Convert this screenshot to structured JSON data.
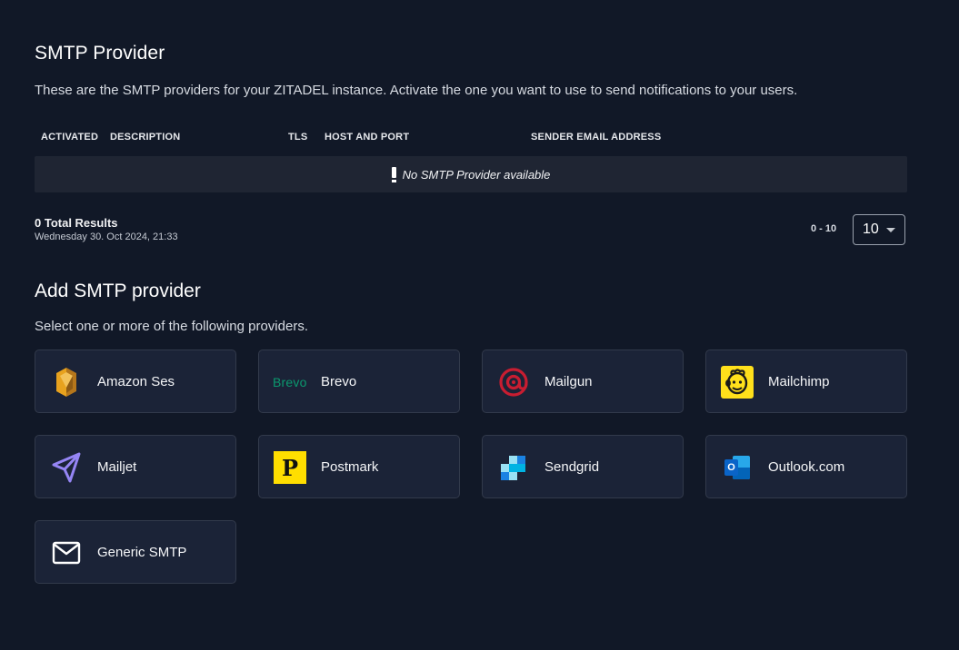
{
  "smtp_section": {
    "title": "SMTP Provider",
    "description": "These are the SMTP providers for your ZITADEL instance. Activate the one you want to use to send notifications to your users.",
    "columns": [
      "ACTIVATED",
      "DESCRIPTION",
      "TLS",
      "HOST AND PORT",
      "SENDER EMAIL ADDRESS"
    ],
    "empty_message": "No SMTP Provider available",
    "total_results": "0 Total Results",
    "timestamp": "Wednesday 30. Oct 2024, 21:33",
    "range": "0 - 10",
    "page_size": "10"
  },
  "add_section": {
    "title": "Add SMTP provider",
    "description": "Select one or more of the following providers.",
    "providers": [
      {
        "label": "Amazon Ses",
        "icon": "amazon-ses-icon"
      },
      {
        "label": "Brevo",
        "icon": "brevo-logo",
        "logo_text": "Brevo"
      },
      {
        "label": "Mailgun",
        "icon": "mailgun-icon"
      },
      {
        "label": "Mailchimp",
        "icon": "mailchimp-icon"
      },
      {
        "label": "Mailjet",
        "icon": "mailjet-icon"
      },
      {
        "label": "Postmark",
        "icon": "postmark-icon",
        "logo_text": "P"
      },
      {
        "label": "Sendgrid",
        "icon": "sendgrid-icon"
      },
      {
        "label": "Outlook.com",
        "icon": "outlook-icon",
        "logo_text": "O"
      },
      {
        "label": "Generic SMTP",
        "icon": "envelope-icon"
      }
    ]
  },
  "colors": {
    "background": "#111827",
    "card": "#1b2337",
    "card_border": "#323a4b",
    "empty_row": "#1f2533",
    "brevo_green": "#0b996e",
    "mailgun_red": "#c81d31",
    "mailchimp_yellow": "#ffe01b",
    "postmark_yellow": "#ffde00",
    "mailjet_purple": "#9585f4",
    "sendgrid_blue": "#1a82e2",
    "outlook_blue": "#0a64c8"
  }
}
